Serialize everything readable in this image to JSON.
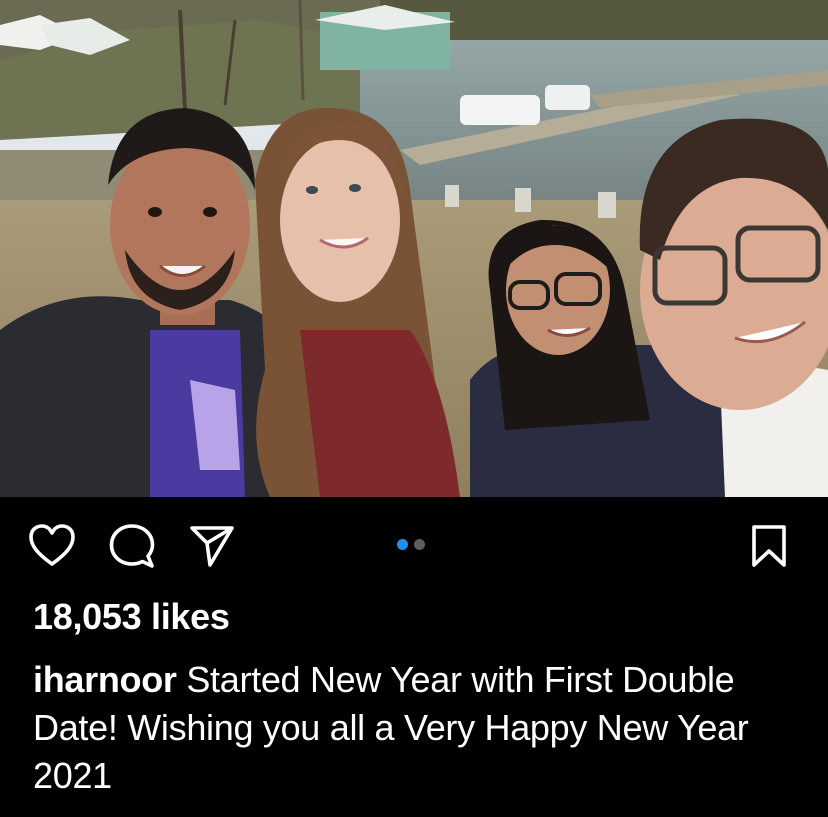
{
  "post": {
    "image_alt": "Four friends taking a selfie in front of a lake with docked boats",
    "image_count": 2,
    "current_image": 1
  },
  "actions": {
    "like_icon": "heart-icon",
    "comment_icon": "comment-icon",
    "share_icon": "paper-plane-icon",
    "save_icon": "bookmark-icon"
  },
  "likes": {
    "text": "18,053 likes"
  },
  "caption": {
    "username": "iharnoor",
    "text": "Started New Year with First Double Date! Wishing you all a Very Happy New Year 2021"
  },
  "colors": {
    "background": "#000000",
    "text": "#ffffff",
    "active_dot": "#1f8ef1",
    "inactive_dot": "#5e5e5e"
  }
}
